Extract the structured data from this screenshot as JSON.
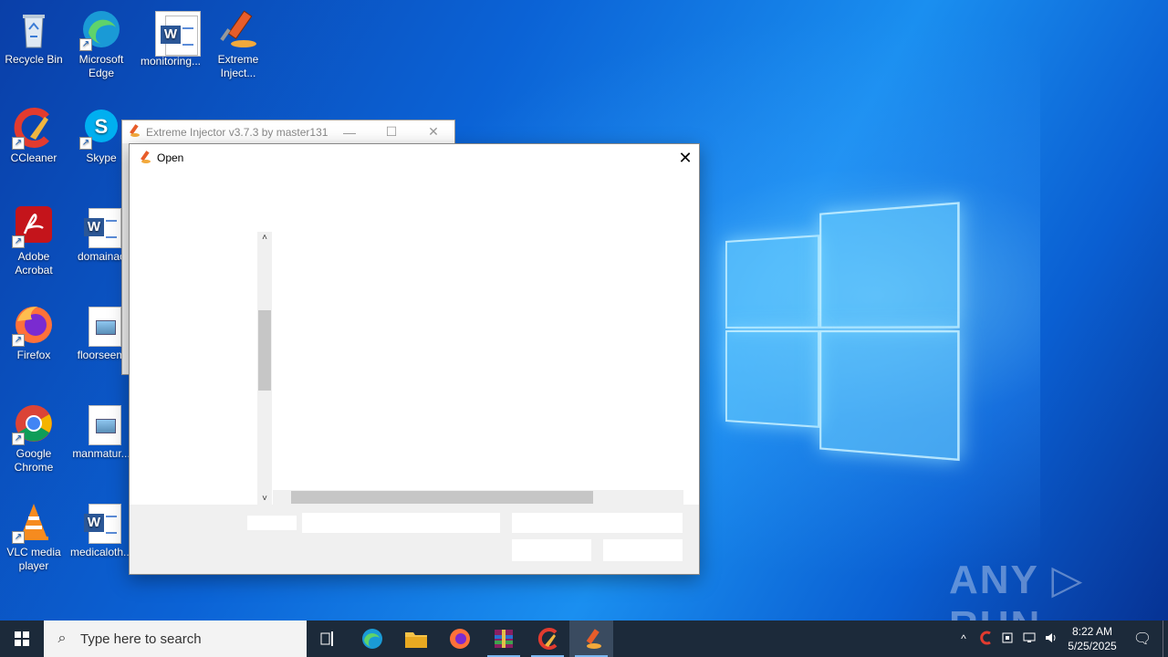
{
  "desktop": {
    "icons": [
      {
        "label": "Recycle Bin",
        "icon": "recycle-bin-icon"
      },
      {
        "label": "Microsoft Edge",
        "icon": "edge-icon"
      },
      {
        "label": "monitoring...",
        "icon": "word-doc-icon"
      },
      {
        "label": "Extreme Inject...",
        "icon": "injector-icon"
      },
      {
        "label": "CCleaner",
        "icon": "ccleaner-icon"
      },
      {
        "label": "Skype",
        "icon": "skype-icon"
      },
      {
        "label": "Adobe Acrobat",
        "icon": "acrobat-icon"
      },
      {
        "label": "domainac",
        "icon": "word-doc-icon"
      },
      {
        "label": "Firefox",
        "icon": "firefox-icon"
      },
      {
        "label": "floorseem",
        "icon": "image-file-icon"
      },
      {
        "label": "Google Chrome",
        "icon": "chrome-icon"
      },
      {
        "label": "manmatur...",
        "icon": "image-file-icon"
      },
      {
        "label": "VLC media player",
        "icon": "vlc-icon"
      },
      {
        "label": "medicaloth...",
        "icon": "word-doc-icon"
      }
    ]
  },
  "background_window": {
    "title": "Extreme Injector v3.7.3 by master131",
    "controls": [
      "—",
      "☐",
      "✕"
    ]
  },
  "open_dialog": {
    "title": "Open",
    "close": "✕",
    "scroll_up": "˄",
    "scroll_down": "˅"
  },
  "watermark": "ANY ▷ RUN",
  "taskbar": {
    "search_placeholder": "Type here to search",
    "items": [
      "task-view",
      "edge",
      "file-explorer",
      "firefox",
      "winrar",
      "ccleaner",
      "extreme-injector"
    ],
    "clock_time": "8:22 AM",
    "clock_date": "5/25/2025",
    "tray_chevron": "^",
    "notifications": "🗨"
  },
  "colors": {
    "accent": "#0b63d6",
    "taskbar": "#1c2a3a"
  }
}
